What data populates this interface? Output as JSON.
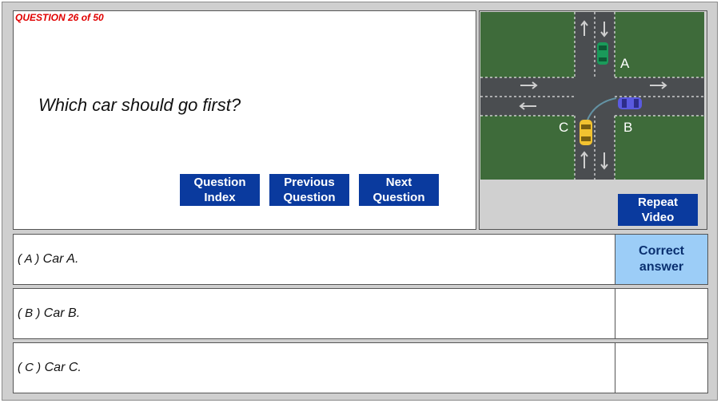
{
  "question": {
    "counter": "QUESTION 26 of 50",
    "text": "Which car should go first?"
  },
  "nav": {
    "question_index": "Question\nIndex",
    "previous_question": "Previous\nQuestion",
    "next_question": "Next\nQuestion"
  },
  "video": {
    "repeat_label": "Repeat\nVideo",
    "car_labels": {
      "a": "A",
      "b": "B",
      "c": "C"
    },
    "car_colors": {
      "a": "#1a9a5a",
      "b": "#5a5ae0",
      "c": "#f2c230"
    }
  },
  "answers": [
    {
      "letter": "( A )",
      "text": "Car A.",
      "result": "Correct\nanswer"
    },
    {
      "letter": "( B )",
      "text": "Car B.",
      "result": ""
    },
    {
      "letter": "( C )",
      "text": "Car C.",
      "result": ""
    }
  ],
  "colors": {
    "button_blue": "#0a3a9e",
    "correct_highlight": "#9ccdf7",
    "counter_red": "#e00000"
  }
}
